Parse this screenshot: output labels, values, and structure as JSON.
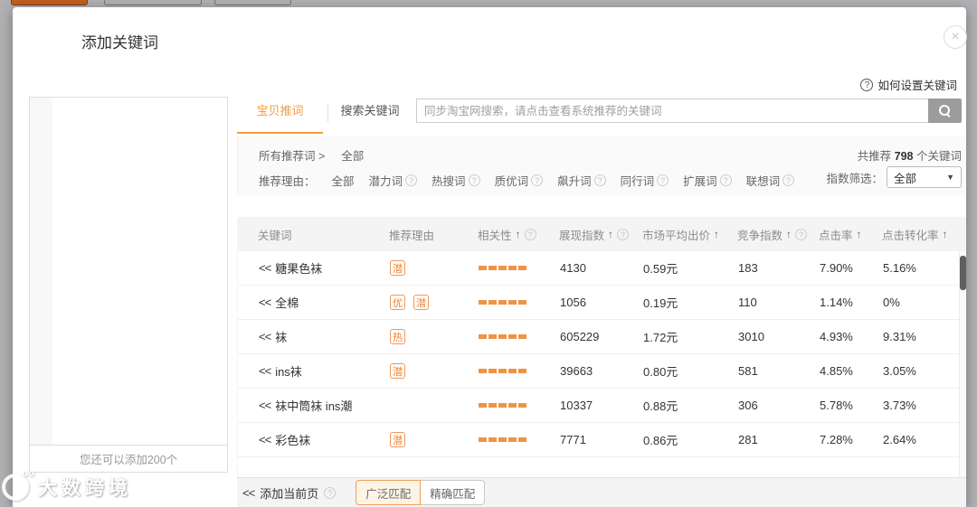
{
  "dialog": {
    "title": "添加关键词",
    "help_link": "如何设置关键词"
  },
  "icons": {
    "close": "×",
    "help": "?",
    "sort_arrow": "↑",
    "caret": "▼",
    "search": "magnifier"
  },
  "colors": {
    "accent": "#f59b3c",
    "badge_border": "#f0975a",
    "badge_text": "#ee8233",
    "relevance_bar": "#ee9445",
    "header_bg": "#f4f4f4",
    "match_active_bg": "#fdf3e6",
    "top_button": "#c05f1f"
  },
  "tabs": [
    {
      "label": "宝贝推词",
      "active": true
    },
    {
      "label": "搜索关键词",
      "active": false
    }
  ],
  "search": {
    "placeholder": "同步淘宝网搜索，请点击查看系统推荐的关键词"
  },
  "left_panel": {
    "footer_note": "您还可以添加200个"
  },
  "filters": {
    "breadcrumb_label": "所有推荐词 >",
    "breadcrumb_value": "全部",
    "reason_label": "推荐理由：",
    "options": [
      {
        "label": "全部",
        "help": false
      },
      {
        "label": "潜力词",
        "help": true
      },
      {
        "label": "热搜词",
        "help": true
      },
      {
        "label": "质优词",
        "help": true
      },
      {
        "label": "飙升词",
        "help": true
      },
      {
        "label": "同行词",
        "help": true
      },
      {
        "label": "扩展词",
        "help": true
      },
      {
        "label": "联想词",
        "help": true
      }
    ],
    "total_prefix": "共推荐",
    "total_count": "798",
    "total_suffix": "个关键词",
    "index_filter_label": "指数筛选：",
    "index_filter_value": "全部"
  },
  "table": {
    "add_symbol": "<<",
    "columns": [
      {
        "label": "关键词",
        "arrow": false,
        "help": false
      },
      {
        "label": "推荐理由",
        "arrow": false,
        "help": false
      },
      {
        "label": "相关性",
        "arrow": true,
        "help": true
      },
      {
        "label": "展现指数",
        "arrow": true,
        "help": true
      },
      {
        "label": "市场平均出价",
        "arrow": true,
        "help": false
      },
      {
        "label": "竞争指数",
        "arrow": true,
        "help": true
      },
      {
        "label": "点击率",
        "arrow": true,
        "help": false
      },
      {
        "label": "点击转化率",
        "arrow": true,
        "help": false
      }
    ],
    "rows": [
      {
        "keyword": "糖果色袜",
        "badges": [
          "潜"
        ],
        "relevance": 5,
        "impression": "4130",
        "avg_price": "0.59元",
        "competition": "183",
        "ctr": "7.90%",
        "cvr": "5.16%"
      },
      {
        "keyword": "全棉",
        "badges": [
          "优",
          "潜"
        ],
        "relevance": 5,
        "impression": "1056",
        "avg_price": "0.19元",
        "competition": "110",
        "ctr": "1.14%",
        "cvr": "0%"
      },
      {
        "keyword": "袜",
        "badges": [
          "热"
        ],
        "relevance": 5,
        "impression": "605229",
        "avg_price": "1.72元",
        "competition": "3010",
        "ctr": "4.93%",
        "cvr": "9.31%"
      },
      {
        "keyword": "ins袜",
        "badges": [
          "潜"
        ],
        "relevance": 5,
        "impression": "39663",
        "avg_price": "0.80元",
        "competition": "581",
        "ctr": "4.85%",
        "cvr": "3.05%"
      },
      {
        "keyword": "袜中筒袜 ins潮",
        "badges": [],
        "relevance": 5,
        "impression": "10337",
        "avg_price": "0.88元",
        "competition": "306",
        "ctr": "5.78%",
        "cvr": "3.73%"
      },
      {
        "keyword": "彩色袜",
        "badges": [
          "潜"
        ],
        "relevance": 5,
        "impression": "7771",
        "avg_price": "0.86元",
        "competition": "281",
        "ctr": "7.28%",
        "cvr": "2.64%"
      }
    ],
    "partial_row_visible": true
  },
  "footer_bar": {
    "add_page_label": "添加当前页",
    "match_buttons": [
      {
        "label": "广泛匹配",
        "active": true
      },
      {
        "label": "精确匹配",
        "active": false
      }
    ]
  },
  "watermark": "大数跨境"
}
